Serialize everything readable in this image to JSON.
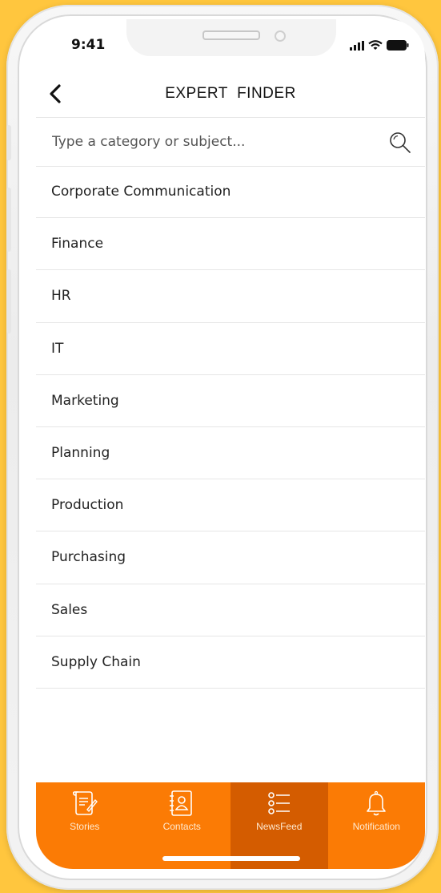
{
  "status_bar": {
    "time": "9:41"
  },
  "header": {
    "title": "EXPERT  FINDER"
  },
  "search": {
    "placeholder": "Type a category or subject..."
  },
  "categories": [
    "Corporate Communication",
    "Finance",
    "HR",
    "IT",
    "Marketing",
    "Planning",
    "Production",
    "Purchasing",
    "Sales",
    "Supply Chain"
  ],
  "tabs": [
    {
      "label": "Stories",
      "icon": "scroll-icon",
      "active": false
    },
    {
      "label": "Contacts",
      "icon": "address-book-icon",
      "active": false
    },
    {
      "label": "NewsFeed",
      "icon": "list-icon",
      "active": true
    },
    {
      "label": "Notification",
      "icon": "bell-icon",
      "active": false
    }
  ],
  "colors": {
    "background": "#ffc63e",
    "tabbar": "#fb7b05",
    "tab_active": "#d45c00"
  }
}
